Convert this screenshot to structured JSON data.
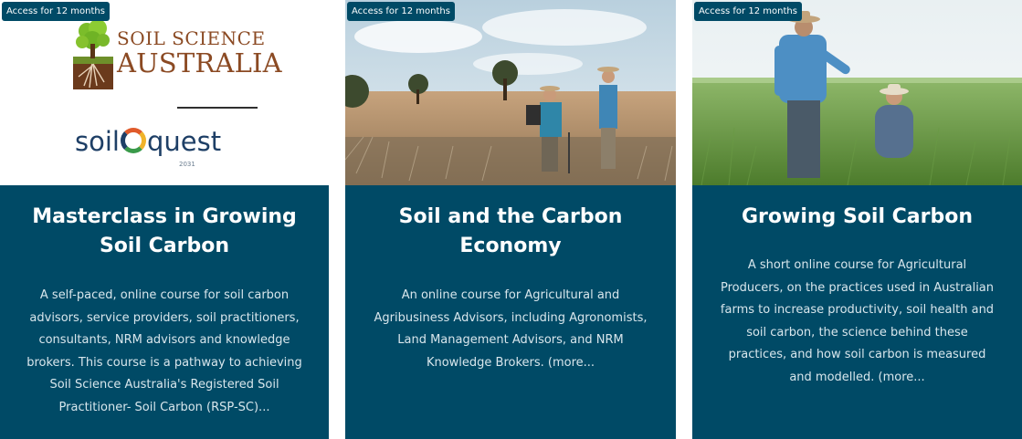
{
  "cards": [
    {
      "badge": "Access for 12 months",
      "logo": {
        "line1": "SOIL SCIENCE",
        "line2": "AUSTRALIA",
        "brand_a": "soil",
        "brand_b": "quest",
        "year": "2031"
      },
      "title_lines": [
        "Masterclass in Growing",
        "Soil Carbon"
      ],
      "desc_lines": [
        "A self-paced, online course for soil carbon",
        "advisors, service providers, soil practitioners,",
        "consultants, NRM advisors and knowledge",
        "brokers. This course is a pathway to achieving",
        "Soil Science Australia's Registered Soil",
        "Practitioner- Soil Carbon (RSP-SC)..."
      ]
    },
    {
      "badge": "Access for 12 months",
      "title_lines": [
        "Soil and the Carbon",
        "Economy"
      ],
      "desc_lines": [
        "An online course for Agricultural and",
        "Agribusiness Advisors, including Agronomists,",
        "Land Management Advisors, and NRM",
        "Knowledge Brokers. (more..."
      ]
    },
    {
      "badge": "Access for 12 months",
      "title_lines": [
        "Growing Soil Carbon"
      ],
      "desc_lines": [
        "A short online course for Agricultural",
        "Producers, on the practices used in Australian",
        "farms to increase productivity, soil health and",
        "soil carbon, the science behind these",
        "practices, and how soil carbon is measured",
        "and modelled. (more..."
      ]
    }
  ],
  "colors": {
    "card_bg": "#004a66",
    "text": "#ffffff",
    "desc_text": "#d8e6ec",
    "ssa_brown": "#8b4a23",
    "soilquest_navy": "#1e3f66"
  }
}
